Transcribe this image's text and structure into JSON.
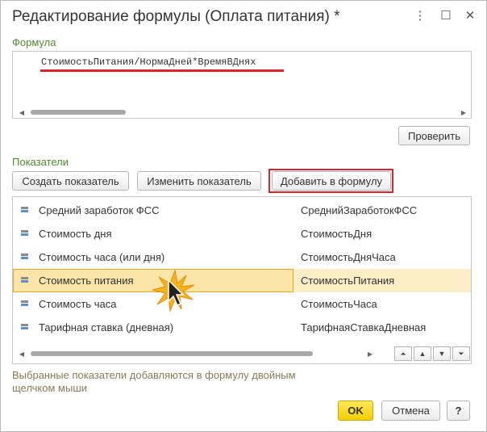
{
  "window": {
    "title": "Редактирование формулы (Оплата питания) *",
    "menu_glyph": "⋮",
    "maximize_glyph": "☐",
    "close_glyph": "✕"
  },
  "formula_section": {
    "label": "Формула",
    "text": "СтоимостьПитания/НормаДней*ВремяВДнях",
    "check_button": "Проверить"
  },
  "indicators_section": {
    "label": "Показатели",
    "create_button": "Создать показатель",
    "edit_button": "Изменить показатель",
    "add_button": "Добавить в формулу"
  },
  "indicators": [
    {
      "name": "Средний заработок ФСС",
      "code": "СреднийЗаработокФСС",
      "selected": false
    },
    {
      "name": "Стоимость дня",
      "code": "СтоимостьДня",
      "selected": false
    },
    {
      "name": "Стоимость часа (или дня)",
      "code": "СтоимостьДняЧаса",
      "selected": false
    },
    {
      "name": "Стоимость питания",
      "code": "СтоимостьПитания",
      "selected": true
    },
    {
      "name": "Стоимость часа",
      "code": "СтоимостьЧаса",
      "selected": false
    },
    {
      "name": "Тарифная ставка (дневная)",
      "code": "ТарифнаяСтавкаДневная",
      "selected": false
    }
  ],
  "hint": "Выбранные показатели добавляются в формулу двойным щелчком мыши",
  "footer": {
    "ok_button": "OK",
    "cancel_button": "Отмена",
    "help_button": "?"
  },
  "colors": {
    "section_label": "#4f8a2c",
    "highlight_border": "#d9262a",
    "selected_row": "#fbe4a8",
    "ok_button": "#f3cd00"
  }
}
